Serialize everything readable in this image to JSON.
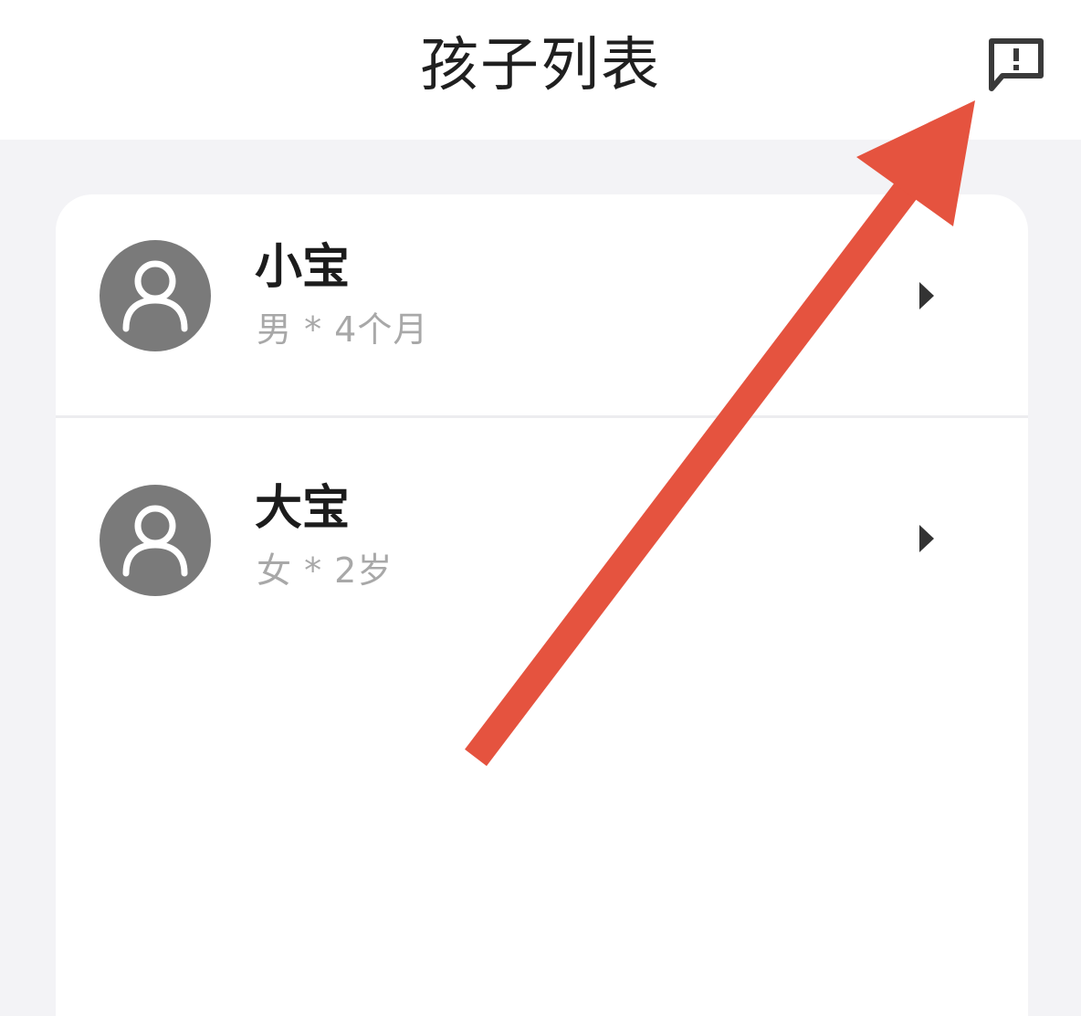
{
  "header": {
    "title": "孩子列表",
    "feedback_icon": "feedback-message-icon"
  },
  "children": [
    {
      "name": "小宝",
      "info": "男 * 4个月",
      "avatar_icon": "person-avatar-icon"
    },
    {
      "name": "大宝",
      "info": "女 * 2岁",
      "avatar_icon": "person-avatar-icon"
    }
  ],
  "colors": {
    "annotation_arrow": "#e5533f",
    "avatar_bg": "#7a7a7a",
    "page_bg": "#f3f3f6"
  }
}
